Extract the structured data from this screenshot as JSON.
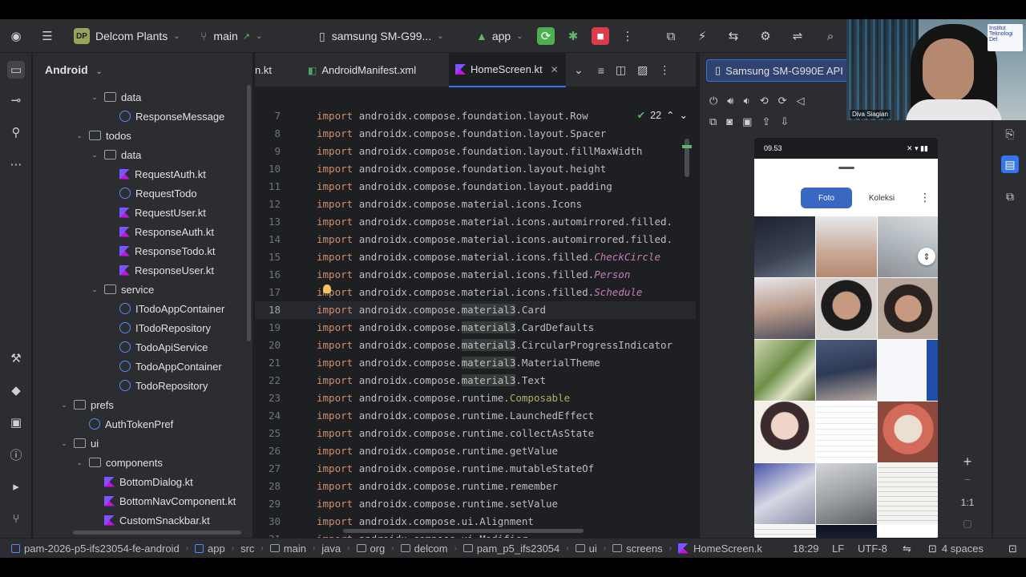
{
  "toolbar": {
    "project_badge": "DP",
    "project_name": "Delcom Plants",
    "branch": "main",
    "branch_arrow": "↗",
    "device": "samsung SM-G99...",
    "run_config": "app"
  },
  "project_panel": {
    "title": "Android",
    "tree": [
      {
        "label": "data",
        "kind": "folder",
        "depth": 2,
        "expanded": true
      },
      {
        "label": "ResponseMessage",
        "kind": "class",
        "depth": 3
      },
      {
        "label": "todos",
        "kind": "folder",
        "depth": 1,
        "expanded": true
      },
      {
        "label": "data",
        "kind": "folder",
        "depth": 2,
        "expanded": true
      },
      {
        "label": "RequestAuth.kt",
        "kind": "kt",
        "depth": 3
      },
      {
        "label": "RequestTodo",
        "kind": "class",
        "depth": 3
      },
      {
        "label": "RequestUser.kt",
        "kind": "kt",
        "depth": 3
      },
      {
        "label": "ResponseAuth.kt",
        "kind": "kt",
        "depth": 3
      },
      {
        "label": "ResponseTodo.kt",
        "kind": "kt",
        "depth": 3
      },
      {
        "label": "ResponseUser.kt",
        "kind": "kt",
        "depth": 3
      },
      {
        "label": "service",
        "kind": "folder",
        "depth": 2,
        "expanded": true
      },
      {
        "label": "ITodoAppContainer",
        "kind": "class",
        "depth": 3
      },
      {
        "label": "ITodoRepository",
        "kind": "class",
        "depth": 3
      },
      {
        "label": "TodoApiService",
        "kind": "class",
        "depth": 3
      },
      {
        "label": "TodoAppContainer",
        "kind": "class",
        "depth": 3
      },
      {
        "label": "TodoRepository",
        "kind": "class",
        "depth": 3
      },
      {
        "label": "prefs",
        "kind": "folder",
        "depth": 0,
        "expanded": true
      },
      {
        "label": "AuthTokenPref",
        "kind": "class",
        "depth": 1
      },
      {
        "label": "ui",
        "kind": "folder",
        "depth": 0,
        "expanded": true
      },
      {
        "label": "components",
        "kind": "folder",
        "depth": 1,
        "expanded": true
      },
      {
        "label": "BottomDialog.kt",
        "kind": "kt",
        "depth": 2
      },
      {
        "label": "BottomNavComponent.kt",
        "kind": "kt",
        "depth": 2
      },
      {
        "label": "CustomSnackbar.kt",
        "kind": "kt",
        "depth": 2
      }
    ]
  },
  "editor": {
    "tabs": [
      {
        "label": "n.kt",
        "active": false
      },
      {
        "label": "AndroidManifest.xml",
        "active": false
      },
      {
        "label": "HomeScreen.kt",
        "active": true
      }
    ],
    "inspection_count": "22",
    "current_line": 18,
    "lines": [
      {
        "n": "7",
        "pkg": "androidx.compose.foundation.layout.",
        "name": "Row",
        "style": "plain"
      },
      {
        "n": "8",
        "pkg": "androidx.compose.foundation.layout.",
        "name": "Spacer",
        "style": "plain"
      },
      {
        "n": "9",
        "pkg": "androidx.compose.foundation.layout.",
        "name": "fillMaxWidth",
        "style": "plain"
      },
      {
        "n": "10",
        "pkg": "androidx.compose.foundation.layout.",
        "name": "height",
        "style": "plain"
      },
      {
        "n": "11",
        "pkg": "androidx.compose.foundation.layout.",
        "name": "padding",
        "style": "plain"
      },
      {
        "n": "12",
        "pkg": "androidx.compose.material.icons.",
        "name": "Icons",
        "style": "plain"
      },
      {
        "n": "13",
        "pkg": "androidx.compose.material.icons.automirrored.filled.",
        "name": "",
        "style": "plain"
      },
      {
        "n": "14",
        "pkg": "androidx.compose.material.icons.automirrored.filled.",
        "name": "",
        "style": "plain"
      },
      {
        "n": "15",
        "pkg": "androidx.compose.material.icons.filled.",
        "name": "CheckCircle",
        "style": "italic"
      },
      {
        "n": "16",
        "pkg": "androidx.compose.material.icons.filled.",
        "name": "Person",
        "style": "italic"
      },
      {
        "n": "17",
        "pkg": "androidx.compose.material.icons.filled.",
        "name": "Schedule",
        "style": "italic"
      },
      {
        "n": "18",
        "pkg": "androidx.compose.material3.",
        "name": "Card",
        "style": "plain",
        "hl": true
      },
      {
        "n": "19",
        "pkg": "androidx.compose.material3.",
        "name": "CardDefaults",
        "style": "plain",
        "hl": true
      },
      {
        "n": "20",
        "pkg": "androidx.compose.material3.",
        "name": "CircularProgressIndicator",
        "style": "plain",
        "hl": true
      },
      {
        "n": "21",
        "pkg": "androidx.compose.material3.",
        "name": "MaterialTheme",
        "style": "plain",
        "hl": true
      },
      {
        "n": "22",
        "pkg": "androidx.compose.material3.",
        "name": "Text",
        "style": "plain",
        "hl": true
      },
      {
        "n": "23",
        "pkg": "androidx.compose.runtime.",
        "name": "Composable",
        "style": "annotation"
      },
      {
        "n": "24",
        "pkg": "androidx.compose.runtime.",
        "name": "LaunchedEffect",
        "style": "plain"
      },
      {
        "n": "25",
        "pkg": "androidx.compose.runtime.",
        "name": "collectAsState",
        "style": "plain"
      },
      {
        "n": "26",
        "pkg": "androidx.compose.runtime.",
        "name": "getValue",
        "style": "plain"
      },
      {
        "n": "27",
        "pkg": "androidx.compose.runtime.",
        "name": "mutableStateOf",
        "style": "plain"
      },
      {
        "n": "28",
        "pkg": "androidx.compose.runtime.",
        "name": "remember",
        "style": "plain"
      },
      {
        "n": "29",
        "pkg": "androidx.compose.runtime.",
        "name": "setValue",
        "style": "plain"
      },
      {
        "n": "30",
        "pkg": "androidx.compose.ui.",
        "name": "Alignment",
        "style": "plain"
      },
      {
        "n": "31",
        "pkg": "androidx.compose.ui.",
        "name": "Modifier",
        "style": "plain"
      }
    ]
  },
  "devices": {
    "tab_label": "Samsung SM-G990E API",
    "phone": {
      "time": "09.53",
      "tab_foto": "Foto",
      "tab_koleksi": "Koleksi"
    },
    "zoom_plus": "+",
    "zoom_minus": "−",
    "zoom_ratio": "1:1"
  },
  "statusbar": {
    "breadcrumbs": [
      "pam-2026-p5-ifs23054-fe-android",
      "app",
      "src",
      "main",
      "java",
      "org",
      "delcom",
      "pam_p5_ifs23054",
      "ui",
      "screens",
      "HomeScreen.k"
    ],
    "position": "18:29",
    "line_sep": "LF",
    "encoding": "UTF-8",
    "indent": "4 spaces"
  },
  "webcam": {
    "name": "Diva Siagian",
    "logo_text": "Institut Teknologi Del"
  },
  "colors": {
    "accent": "#3574f0",
    "run": "#4caf50",
    "stop": "#db3b4b",
    "keyword": "#cf8e6d",
    "italic_member": "#c77dbb",
    "annotation": "#b3ae60"
  }
}
